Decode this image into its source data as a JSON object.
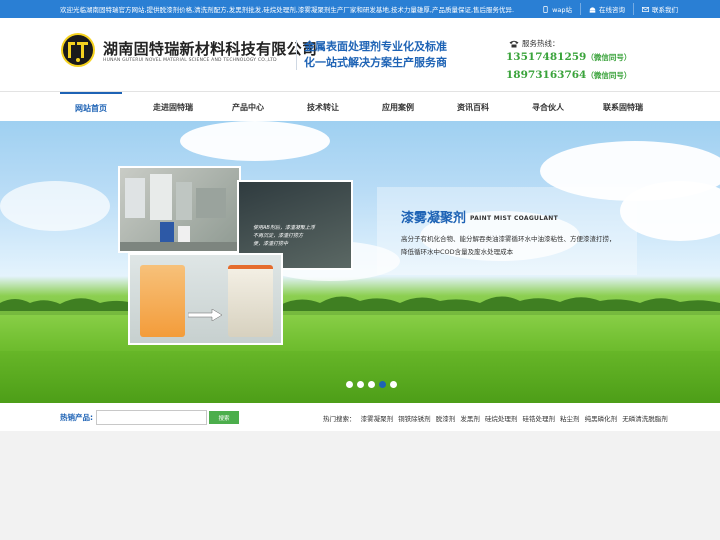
{
  "topbar": {
    "welcome": "欢迎光临湖南固特瑞官方网站,提供脱漆剂价格,清洗剂配方,发黑剂批发,硅烷处理剂,漆雾凝聚剂生产厂家和研发基地,技术力量雄厚,产品质量保证,售后服务优异.",
    "links": [
      "wap站",
      "在线咨询",
      "联系我们"
    ],
    "color": "#2a7fd4"
  },
  "header": {
    "brand_cn": "湖南固特瑞新材料科技有限公司",
    "brand_en": "HUNAN GUTERUI NOVEL MATERIAL SCIENCE AND TECHNOLOGY CO.,LTD",
    "slogan_line1": "金属表面处理剂专业化及标准",
    "slogan_line2": "化一站式解决方案生产服务商",
    "hotline_label": "服务热线：",
    "phones": [
      {
        "number": "13517481259",
        "note": "（微信同号）"
      },
      {
        "number": "18973163764",
        "note": "（微信同号）"
      }
    ],
    "accent": "#1e63b5",
    "phone_color": "#3aa33b"
  },
  "nav": {
    "items": [
      "网站首页",
      "走进固特瑞",
      "产品中心",
      "技术转让",
      "应用案例",
      "资讯百科",
      "寻合伙人",
      "联系固特瑞"
    ],
    "active_index": 0
  },
  "banner": {
    "title": "漆雾凝聚剂",
    "title_en": "PAINT MIST COAGULANT",
    "desc_line1": "高分子有机化合物、能分解吞类油漆雾循环水中油漆粘性、方便漆渣打捞，",
    "desc_line2": "降低循环水中COD含量及废水处理成本",
    "photo_caption_line1": "使用AB剂后，漆渣凝聚上浮",
    "photo_caption_line2": "不再沉淀，漆渣打捞方",
    "photo_caption_line3": "便，漆渣打捞中",
    "slide_count": 5,
    "active_slide": 3
  },
  "search": {
    "label": "热销产品:",
    "placeholder": "",
    "button": "搜索",
    "hot_label": "热门搜索：",
    "hot_terms": [
      "漆雾凝聚剂",
      "铜铁除锈剂",
      "脱漆剂",
      "发黑剂",
      "硅烷处理剂",
      "硅锆处理剂",
      "粘尘剂",
      "纯黑磷化剂",
      "无磷清洗脱脂剂"
    ]
  }
}
